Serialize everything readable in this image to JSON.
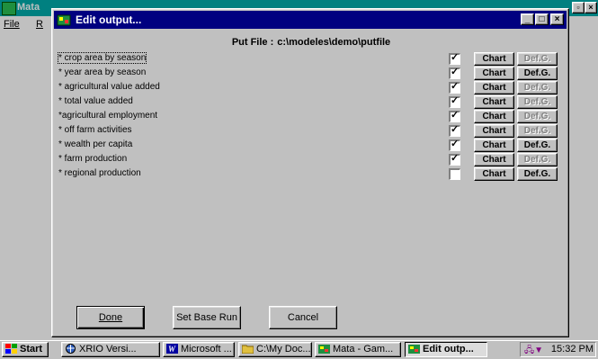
{
  "bg_window": {
    "title": "Mata",
    "menu": [
      "File",
      "R"
    ]
  },
  "dialog": {
    "title": "Edit output...",
    "put_file_label": "Put File :",
    "put_file_path": "c:\\modeles\\demo\\putfile",
    "rows": [
      {
        "label": "* crop area by season",
        "checked": true,
        "chart_label": "Chart",
        "defg_label": "Def.G.",
        "defg_enabled": false
      },
      {
        "label": "* year area by season",
        "checked": true,
        "chart_label": "Chart",
        "defg_label": "Def.G.",
        "defg_enabled": true
      },
      {
        "label": "* agricultural value added",
        "checked": true,
        "chart_label": "Chart",
        "defg_label": "Def.G.",
        "defg_enabled": false
      },
      {
        "label": "* total value added",
        "checked": true,
        "chart_label": "Chart",
        "defg_label": "Def.G.",
        "defg_enabled": false
      },
      {
        "label": "*agricultural employment",
        "checked": true,
        "chart_label": "Chart",
        "defg_label": "Def.G.",
        "defg_enabled": false
      },
      {
        "label": "* off farm activities",
        "checked": true,
        "chart_label": "Chart",
        "defg_label": "Def.G.",
        "defg_enabled": false
      },
      {
        "label": "* wealth per capita",
        "checked": true,
        "chart_label": "Chart",
        "defg_label": "Def.G.",
        "defg_enabled": true
      },
      {
        "label": "* farm production",
        "checked": true,
        "chart_label": "Chart",
        "defg_label": "Def.G.",
        "defg_enabled": false
      },
      {
        "label": "* regional production",
        "checked": false,
        "chart_label": "Chart",
        "defg_label": "Def.G.",
        "defg_enabled": true
      }
    ],
    "buttons": {
      "done": "Done",
      "set_base_run": "Set Base Run",
      "cancel": "Cancel"
    },
    "check_glyph": "✓"
  },
  "taskbar": {
    "start": "Start",
    "items": [
      {
        "label": "XRIO Versi...",
        "icon": "globe-icon"
      },
      {
        "label": "Microsoft ...",
        "icon": "word-icon"
      },
      {
        "label": "C:\\My Doc...",
        "icon": "folder-icon"
      },
      {
        "label": "Mata - Gam...",
        "icon": "app-icon"
      },
      {
        "label": "Edit outp...",
        "icon": "app-icon",
        "active": true
      }
    ],
    "clock": "15:32 PM"
  },
  "colors": {
    "desktop_face": "#c0c0c0",
    "dialog_title_bar": "#000080",
    "bg_title_bar": "#008080"
  }
}
